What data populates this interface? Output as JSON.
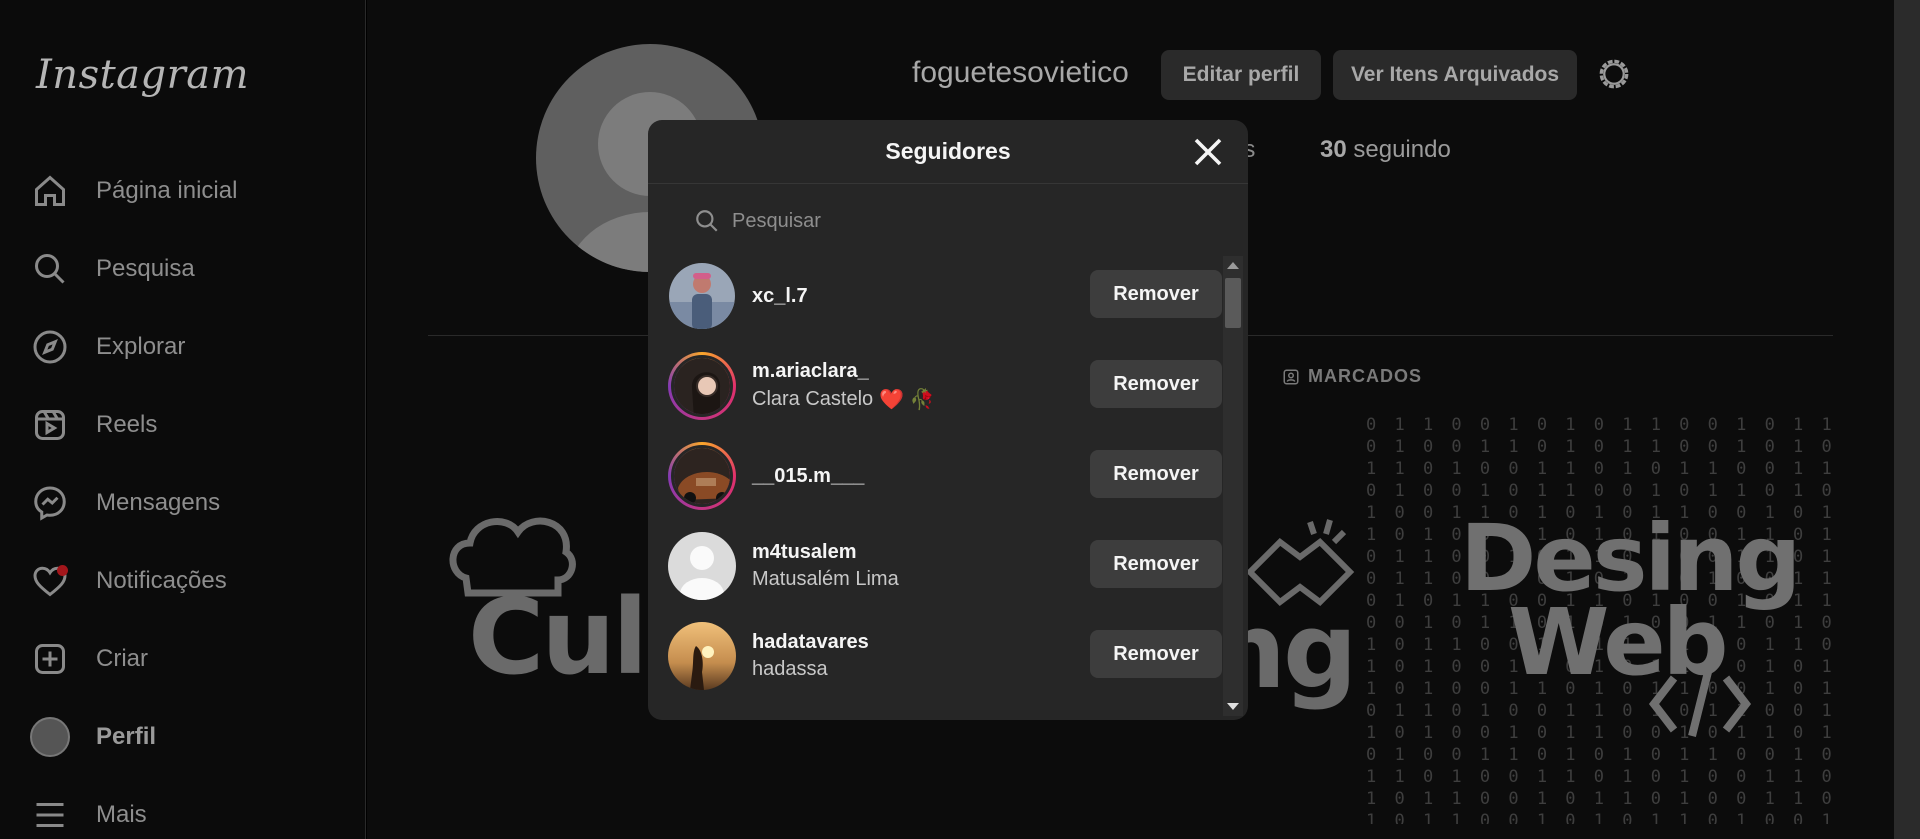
{
  "sidebar": {
    "logo": "Instagram",
    "items": [
      {
        "label": "Página inicial",
        "icon": "home-icon"
      },
      {
        "label": "Pesquisa",
        "icon": "search-icon"
      },
      {
        "label": "Explorar",
        "icon": "compass-icon"
      },
      {
        "label": "Reels",
        "icon": "reels-icon"
      },
      {
        "label": "Mensagens",
        "icon": "messenger-icon"
      },
      {
        "label": "Notificações",
        "icon": "heart-icon"
      },
      {
        "label": "Criar",
        "icon": "plus-square-icon"
      },
      {
        "label": "Perfil",
        "icon": "avatar"
      },
      {
        "label": "Mais",
        "icon": "menu-icon"
      }
    ]
  },
  "profile": {
    "username": "foguetesovietico",
    "edit_label": "Editar perfil",
    "archive_label": "Ver Itens Arquivados",
    "followers_partial": "es",
    "following_count": "30",
    "following_label": "seguindo",
    "tab_marked": "MARCADOS",
    "posts": [
      "Culin",
      "ng",
      "Desing",
      "Web"
    ]
  },
  "modal": {
    "title": "Seguidores",
    "search_placeholder": "Pesquisar",
    "remove_label": "Remover",
    "followers": [
      {
        "username": "xc_l.7",
        "name": "",
        "ring": false,
        "avatar_color": "#8a9bb5"
      },
      {
        "username": "m.ariaclara_",
        "name": "Clara Castelo",
        "emoji": "❤️ 🥀",
        "ring": true,
        "avatar_color": "#3a2f2c"
      },
      {
        "username": "__015.m___",
        "name": "",
        "ring": true,
        "avatar_color": "#6b3b24"
      },
      {
        "username": "m4tusalem",
        "name": "Matusalém Lima",
        "ring": false,
        "avatar_color": "#dbdbdb"
      },
      {
        "username": "hadatavares",
        "name": "hadassa",
        "ring": false,
        "avatar_color": "#c58d4e"
      }
    ]
  }
}
